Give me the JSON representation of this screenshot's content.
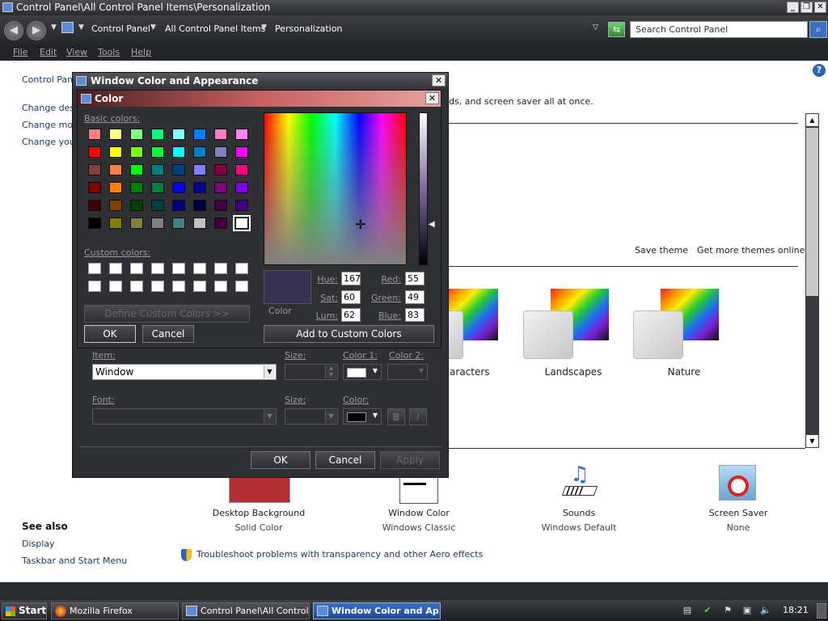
{
  "window": {
    "title": "Control Panel\\All Control Panel Items\\Personalization",
    "minimize": "_",
    "maximize": "❐",
    "close": "✕"
  },
  "address": {
    "back": "◀",
    "forward": "▶",
    "crumbs": [
      "Control Panel",
      "All Control Panel Items",
      "Personalization"
    ],
    "search_placeholder": "Search Control Panel",
    "search_icon": "magnifier-icon",
    "refresh_icon": "refresh-icon"
  },
  "menu": [
    "File",
    "Edit",
    "View",
    "Tools",
    "Help"
  ],
  "left_links": {
    "home": "Control Panel",
    "items": [
      "Change desk",
      "Change mou",
      "Change your"
    ]
  },
  "content": {
    "intro": "ds, and screen saver all at once.",
    "save_theme": "Save theme",
    "get_more": "Get more themes online",
    "themes": [
      "haracters",
      "Landscapes",
      "Nature"
    ]
  },
  "bottom": {
    "items": [
      {
        "label": "Desktop Background",
        "sub": "Solid Color"
      },
      {
        "label": "Window Color",
        "sub": "Windows Classic"
      },
      {
        "label": "Sounds",
        "sub": "Windows Default"
      },
      {
        "label": "Screen Saver",
        "sub": "None"
      }
    ],
    "desktop_color": "#b22f33",
    "troubleshoot": "Troubleshoot problems with transparency and other Aero effects"
  },
  "see_also": {
    "heading": "See also",
    "links": [
      "Display",
      "Taskbar and Start Menu"
    ]
  },
  "wca_dialog": {
    "title": "Window Color and Appearance",
    "close": "✕",
    "item_label": "Item:",
    "item_value": "Window",
    "size_label": "Size:",
    "color1_label": "Color 1:",
    "color2_label": "Color 2:",
    "font_label": "Font:",
    "size2_label": "Size:",
    "color_label": "Color:",
    "bold": "B",
    "italic": "I",
    "ok": "OK",
    "cancel": "Cancel",
    "apply": "Apply"
  },
  "color_dialog": {
    "title": "Color",
    "close": "✕",
    "basic_colors_label": "Basic colors:",
    "custom_colors_label": "Custom colors:",
    "define_custom": "Define Custom Colors >>",
    "ok": "OK",
    "cancel": "Cancel",
    "add_custom": "Add to Custom Colors",
    "color_solid_label": "Color",
    "hue_label": "Hue:",
    "hue": "167",
    "sat_label": "Sat:",
    "sat": "60",
    "lum_label": "Lum:",
    "lum": "62",
    "red_label": "Red:",
    "red": "55",
    "green_label": "Green:",
    "green": "49",
    "blue_label": "Blue:",
    "blue": "83",
    "preview_color": "#373153",
    "basic_colors": [
      [
        "#ff8080",
        "#ffff80",
        "#80ff80",
        "#00ff80",
        "#80ffff",
        "#0080ff",
        "#ff80c0",
        "#ff80ff"
      ],
      [
        "#ff0000",
        "#ffff00",
        "#80ff00",
        "#00ff40",
        "#00ffff",
        "#0080c0",
        "#8080c0",
        "#ff00ff"
      ],
      [
        "#804040",
        "#ff8040",
        "#00ff00",
        "#008080",
        "#004080",
        "#8080ff",
        "#800040",
        "#ff0080"
      ],
      [
        "#800000",
        "#ff8000",
        "#008000",
        "#008040",
        "#0000ff",
        "#0000a0",
        "#800080",
        "#8000ff"
      ],
      [
        "#400000",
        "#804000",
        "#004000",
        "#004040",
        "#000080",
        "#000040",
        "#400040",
        "#400080"
      ],
      [
        "#000000",
        "#808000",
        "#808040",
        "#808080",
        "#408080",
        "#c0c0c0",
        "#400040",
        "#ffffff"
      ]
    ]
  },
  "taskbar": {
    "start": "Start",
    "tasks": [
      "Mozilla Firefox",
      "Control Panel\\All Control ...",
      "Window Color and Ap..."
    ],
    "clock": "18:21"
  }
}
